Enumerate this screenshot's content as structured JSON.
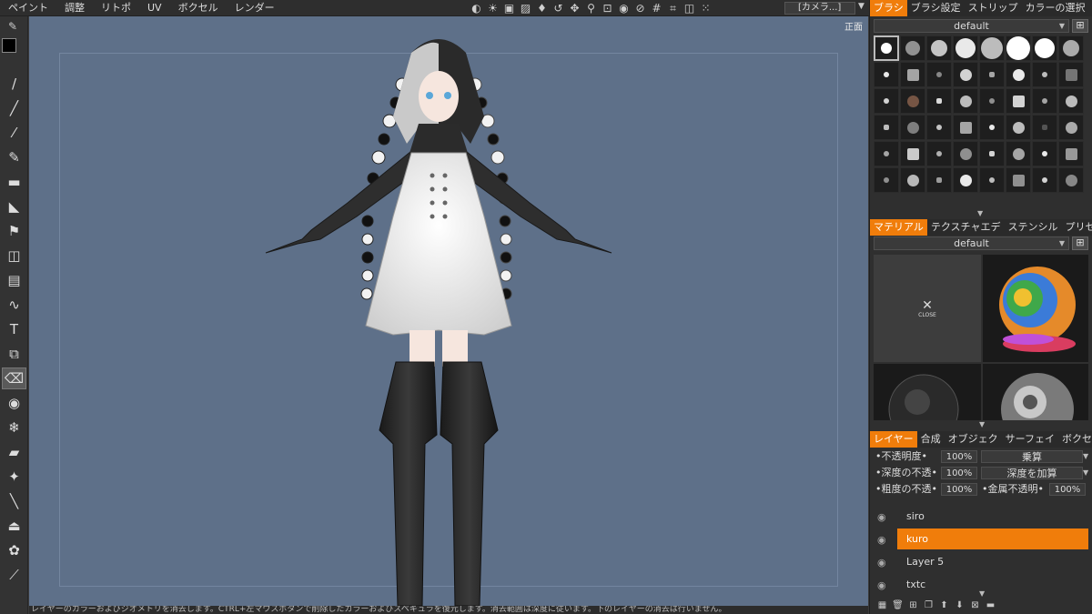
{
  "menu": {
    "items": [
      "ペイント",
      "調整",
      "リトポ",
      "UV",
      "ボクセル",
      "レンダー"
    ],
    "active_index": 0
  },
  "toolbar_icons": [
    "half-circle-icon",
    "light-icon",
    "image-icon",
    "image-alt-icon",
    "drop-icon",
    "rotate-icon",
    "move-icon",
    "zoom-icon",
    "crop-icon",
    "camera-icon",
    "no-icon",
    "grid-icon",
    "corner-icon",
    "screen-icon",
    "scatter-icon"
  ],
  "toolbar_glyphs": [
    "◐",
    "☀",
    "▣",
    "▨",
    "♦",
    "↺",
    "✥",
    "⚲",
    "⊡",
    "◉",
    "⊘",
    "#",
    "⌗",
    "◫",
    "⁙"
  ],
  "camera": {
    "value": "[カメラ...]"
  },
  "left_tools": [
    {
      "name": "pen-icon",
      "glyph": "/"
    },
    {
      "name": "brush-icon",
      "glyph": "╱"
    },
    {
      "name": "airbrush-icon",
      "glyph": "⁄"
    },
    {
      "name": "pencil-icon",
      "glyph": "✎"
    },
    {
      "name": "smudge-icon",
      "glyph": "▬"
    },
    {
      "name": "fill-icon",
      "glyph": "◣"
    },
    {
      "name": "stamp-icon",
      "glyph": "⚑"
    },
    {
      "name": "stencil-icon",
      "glyph": "◫"
    },
    {
      "name": "document-icon",
      "glyph": "▤"
    },
    {
      "name": "path-icon",
      "glyph": "∿"
    },
    {
      "name": "text-icon",
      "glyph": "T"
    },
    {
      "name": "transform-icon",
      "glyph": "⧉"
    },
    {
      "name": "eraser-icon",
      "glyph": "⌫"
    },
    {
      "name": "eye-icon",
      "glyph": "◉"
    },
    {
      "name": "snowflake-icon",
      "glyph": "❄"
    },
    {
      "name": "tube-icon",
      "glyph": "▰"
    },
    {
      "name": "wand-icon",
      "glyph": "✦"
    },
    {
      "name": "picker-icon",
      "glyph": "╲"
    },
    {
      "name": "iron-icon",
      "glyph": "⏏"
    },
    {
      "name": "butterfly-icon",
      "glyph": "✿"
    },
    {
      "name": "ruler-icon",
      "glyph": "⟋"
    }
  ],
  "active_tool_index": 12,
  "viewport": {
    "view_label": "正面"
  },
  "status_text": "レイヤーのカラーおよびジオメトリを消去します。CTRL+左マウスボタンで削除したカラーおよびスペキュラを復元します。消去範囲は深度に従います。下のレイヤーの消去は行いません。",
  "brush_panel": {
    "tabs": [
      "ブラシ",
      "ブラシ設定",
      "ストリップ",
      "カラーの選択"
    ],
    "active_index": 0,
    "preset": "default"
  },
  "material_panel": {
    "tabs": [
      "マテリアル",
      "テクスチャエデ",
      "ステンシル",
      "プリセット"
    ],
    "active_index": 0,
    "preset": "default",
    "close_label": "CLOSE",
    "close_glyph": "✕"
  },
  "layer_panel": {
    "tabs": [
      "レイヤー",
      "合成",
      "オブジェク",
      "サーフェイ",
      "ボクセルツ"
    ],
    "active_index": 0,
    "opacity_label": "•不透明度•",
    "opacity_value": "100%",
    "blend_mode": "乗算",
    "depth_label": "•深度の不透•",
    "depth_value": "100%",
    "depth_mode": "深度を加算",
    "rough_label": "•粗度の不透•",
    "rough_value": "100%",
    "metal_label": "•金属不透明•",
    "metal_value": "100%",
    "layers": [
      {
        "name": "siro",
        "selected": false
      },
      {
        "name": "kuro",
        "selected": true
      },
      {
        "name": "Layer 5",
        "selected": false
      },
      {
        "name": "txtc",
        "selected": false
      }
    ]
  }
}
